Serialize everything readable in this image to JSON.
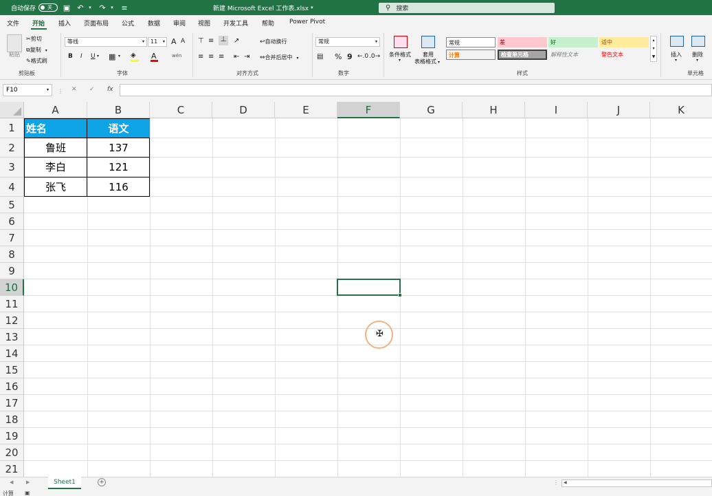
{
  "titlebar": {
    "autosave_label": "自动保存",
    "autosave_state": "关",
    "file_title": "新建 Microsoft Excel 工作表.xlsx",
    "title_caret": "▾",
    "search_placeholder": "搜索",
    "bg_color": "#217346"
  },
  "menu": {
    "tabs": [
      "文件",
      "开始",
      "插入",
      "页面布局",
      "公式",
      "数据",
      "审阅",
      "视图",
      "开发工具",
      "帮助",
      "Power Pivot"
    ],
    "active_index": 1
  },
  "ribbon": {
    "clipboard": {
      "paste": "粘贴",
      "cut": "剪切",
      "copy": "复制",
      "format_painter": "格式刷",
      "group": "剪贴板"
    },
    "font": {
      "name": "等线",
      "size": "11",
      "bold": "B",
      "italic": "I",
      "underline": "U",
      "grow": "A",
      "shrink": "A",
      "font_color": "A",
      "wen": "wén",
      "group": "字体"
    },
    "alignment": {
      "wrap": "自动换行",
      "merge": "合并后居中",
      "group": "对齐方式"
    },
    "number": {
      "format": "常规",
      "percent": "%",
      "comma": "9",
      "group": "数字"
    },
    "styles": {
      "conditional": "条件格式",
      "table_line1": "套用",
      "table_line2": "表格格式",
      "normal": "常规",
      "bad": "差",
      "good": "好",
      "neutral": "适中",
      "calc": "计算",
      "check": "检查单元格",
      "explain": "解释性文本",
      "warning": "警告文本",
      "group": "样式"
    },
    "cells": {
      "insert": "插入",
      "delete": "删除",
      "group": "单元格"
    }
  },
  "formula_bar": {
    "name_box": "F10",
    "cancel": "✕",
    "enter": "✓",
    "fx": "fx",
    "formula": ""
  },
  "grid": {
    "columns": [
      "A",
      "B",
      "C",
      "D",
      "E",
      "F",
      "G",
      "H",
      "I",
      "J",
      "K"
    ],
    "rows": [
      "1",
      "2",
      "3",
      "4",
      "5",
      "6",
      "7",
      "8",
      "9",
      "10",
      "11",
      "12",
      "13",
      "14",
      "15",
      "16",
      "17",
      "18",
      "19",
      "20",
      "21"
    ],
    "selected_column": "F",
    "selected_row": "10",
    "header_fill": "#0fa4e6",
    "table": {
      "headers": [
        "姓名",
        "语文"
      ],
      "rows": [
        [
          "鲁班",
          "137"
        ],
        [
          "李白",
          "121"
        ],
        [
          "张飞",
          "116"
        ]
      ]
    }
  },
  "sheets": {
    "tabs": [
      "Sheet1"
    ],
    "add": "+"
  },
  "status": {
    "mode": "计算",
    "icon": "▣"
  }
}
